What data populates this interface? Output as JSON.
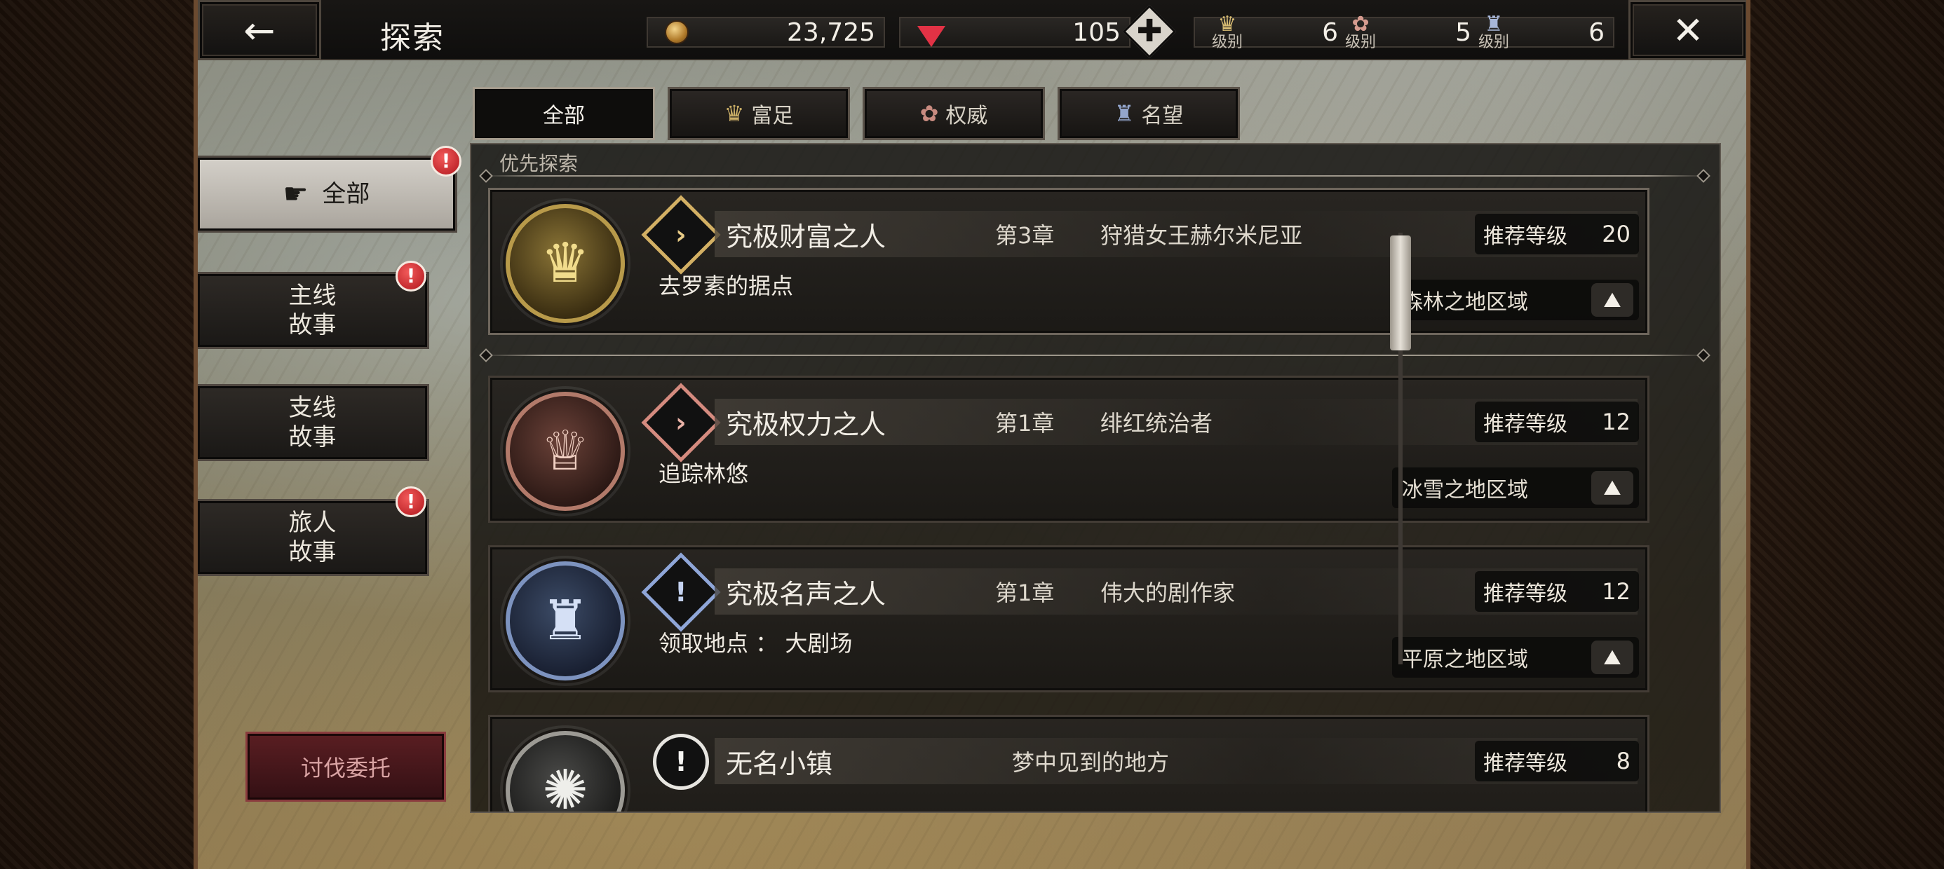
{
  "header": {
    "back_icon": "arrow-left-icon",
    "back_glyph": "←",
    "title": "探索",
    "close_icon": "close-x-icon",
    "close_glyph": "✕"
  },
  "resources": {
    "gold": "23,725",
    "gems": "105",
    "plus_glyph": "✚",
    "levels": [
      {
        "icon": "wealth-crest-icon",
        "glyph": "♛",
        "label": "级别",
        "value": "6"
      },
      {
        "icon": "power-crest-icon",
        "glyph": "✿",
        "label": "级别",
        "value": "5"
      },
      {
        "icon": "fame-crest-icon",
        "glyph": "♜",
        "label": "级别",
        "value": "6"
      }
    ]
  },
  "tabs": [
    {
      "label": "全部",
      "glyph": ""
    },
    {
      "label": "富足",
      "glyph": "♛"
    },
    {
      "label": "权威",
      "glyph": "✿"
    },
    {
      "label": "名望",
      "glyph": "♜"
    }
  ],
  "nav": {
    "items": [
      {
        "label": "全部",
        "pointer": "☛",
        "badge": "!"
      },
      {
        "label": "主线\n故事",
        "badge": "!"
      },
      {
        "label": "支线\n故事",
        "badge": ""
      },
      {
        "label": "旅人\n故事",
        "badge": "!"
      }
    ],
    "subdue_label": "讨伐委托"
  },
  "list": {
    "section_title": "优先探索",
    "rec_label": "推荐等级",
    "quests": [
      {
        "name": "究极财富之人",
        "chapter": "第3章",
        "chapter_title": "狩猎女王赫尔米尼亚",
        "level": "20",
        "desc": "去罗素的据点",
        "region": "森林之地区域",
        "emblem_glyph": "♛",
        "type_glyph": "›"
      },
      {
        "name": "究极权力之人",
        "chapter": "第1章",
        "chapter_title": "绯红统治者",
        "level": "12",
        "desc": "追踪林悠",
        "region": "冰雪之地区域",
        "emblem_glyph": "♕",
        "type_glyph": "›"
      },
      {
        "name": "究极名声之人",
        "chapter": "第1章",
        "chapter_title": "伟大的剧作家",
        "level": "12",
        "desc": "领取地点 ： 大剧场",
        "region": "平原之地区域",
        "emblem_glyph": "♜",
        "type_glyph": "!"
      },
      {
        "name": "无名小镇",
        "chapter": "",
        "chapter_title": "梦中见到的地方",
        "level": "8",
        "desc": "",
        "region": "",
        "emblem_glyph": "✺",
        "type_glyph": "!"
      }
    ],
    "region_glyph": "⛰"
  }
}
